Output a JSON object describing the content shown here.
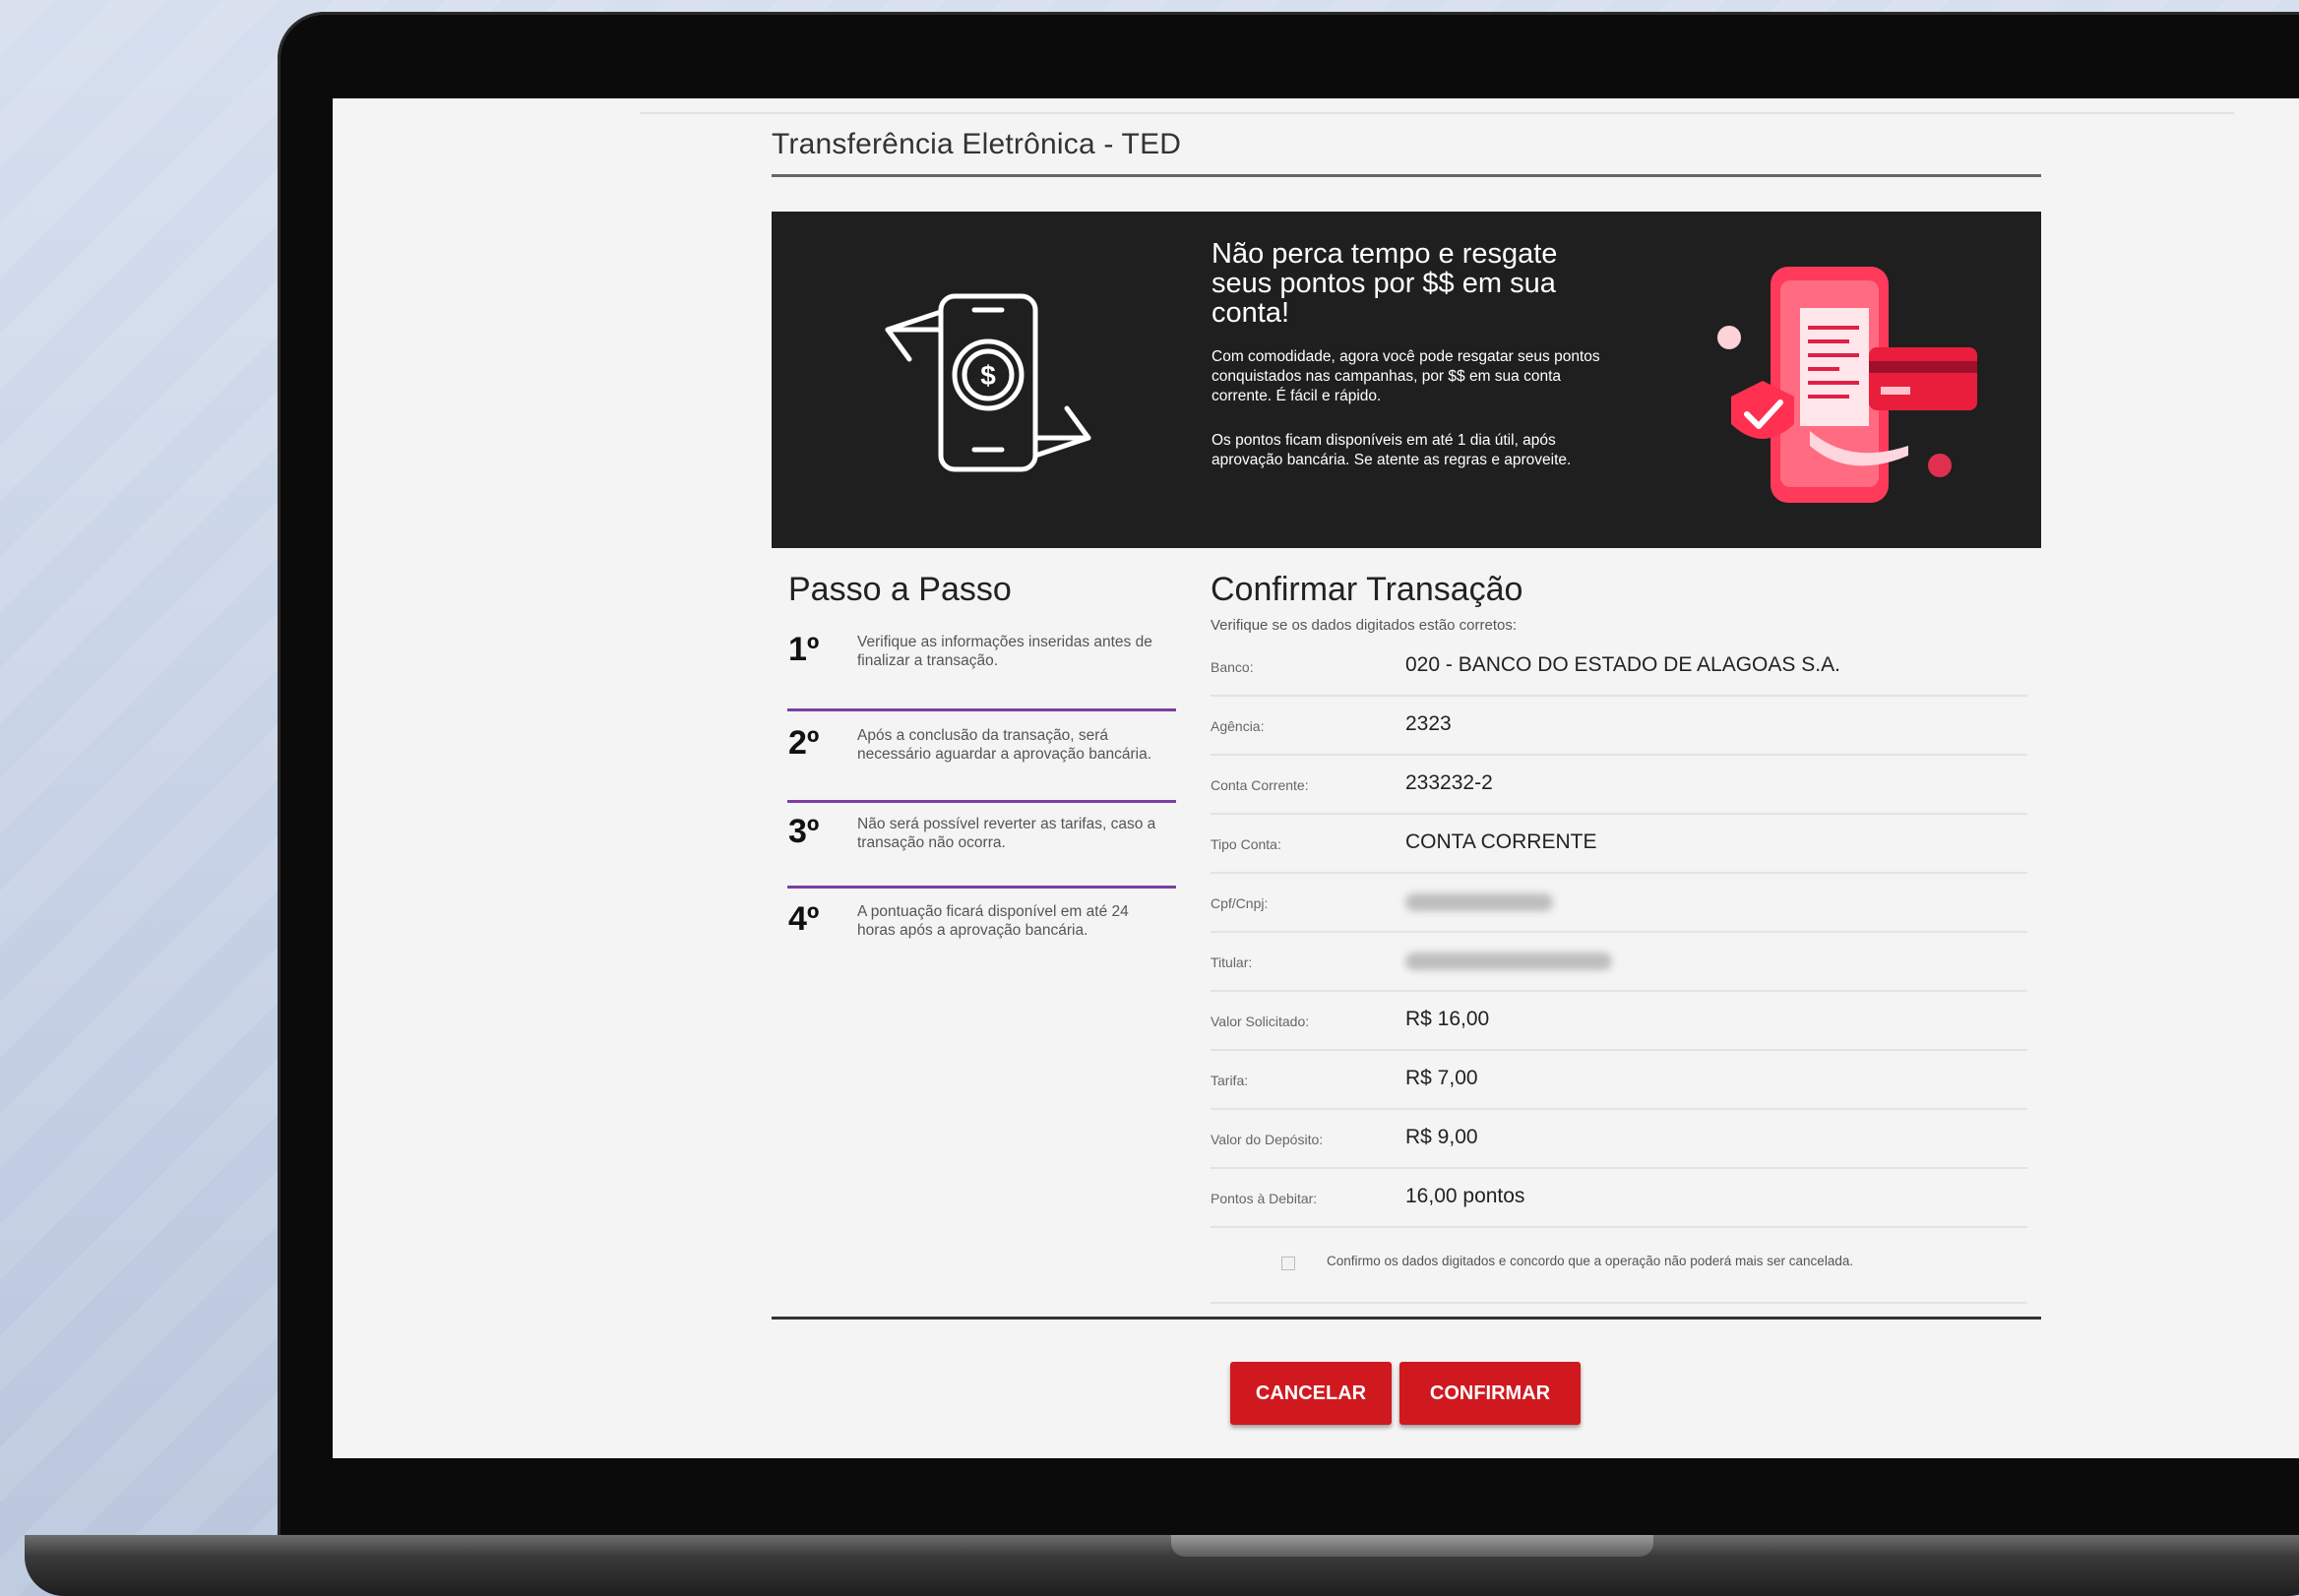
{
  "page": {
    "title": "Transferência Eletrônica - TED"
  },
  "banner": {
    "heading": "Não perca tempo e resgate seus pontos por $$ em sua conta!",
    "paragraph1": "Com comodidade, agora você pode resgatar seus pontos conquistados nas campanhas, por $$ em sua conta corrente. É fácil e rápido.",
    "paragraph2": "Os pontos ficam disponíveis em até 1 dia útil, após aprovação bancária. Se atente as regras e aproveite.",
    "left_icon": "phone-dollar-transfer-icon",
    "right_art": "phone-receipt-card-illustration"
  },
  "steps": {
    "title": "Passo a Passo",
    "items": [
      {
        "num": "1º",
        "text": "Verifique as informações inseridas antes de finalizar a transação."
      },
      {
        "num": "2º",
        "text": "Após a conclusão da transação, será necessário aguardar a aprovação bancária."
      },
      {
        "num": "3º",
        "text": "Não será possível reverter as tarifas, caso a transação não ocorra."
      },
      {
        "num": "4º",
        "text": "A pontuação ficará disponível em até 24 horas após a aprovação bancária."
      }
    ]
  },
  "confirm": {
    "title": "Confirmar Transação",
    "subtitle": "Verifique se os dados digitados estão corretos:",
    "rows": [
      {
        "label": "Banco:",
        "value": "020 - BANCO DO ESTADO DE ALAGOAS S.A."
      },
      {
        "label": "Agência:",
        "value": "2323"
      },
      {
        "label": "Conta Corrente:",
        "value": "233232-2"
      },
      {
        "label": "Tipo Conta:",
        "value": "CONTA CORRENTE"
      },
      {
        "label": "Cpf/Cnpj:",
        "value": ""
      },
      {
        "label": "Titular:",
        "value": ""
      },
      {
        "label": "Valor Solicitado:",
        "value": "R$ 16,00"
      },
      {
        "label": "Tarifa:",
        "value": "R$ 7,00"
      },
      {
        "label": "Valor do Depósito:",
        "value": "R$ 9,00"
      },
      {
        "label": "Pontos à Debitar:",
        "value": "16,00 pontos"
      }
    ],
    "agree_text": "Confirmo os dados digitados e concordo que a operação não poderá mais ser cancelada.",
    "agree_checked": false
  },
  "buttons": {
    "cancel": "CANCELAR",
    "confirm": "CONFIRMAR"
  },
  "colors": {
    "accent_red": "#d0181f",
    "step_divider": "#7a3fa1",
    "banner_bg": "#1f1f1f"
  }
}
